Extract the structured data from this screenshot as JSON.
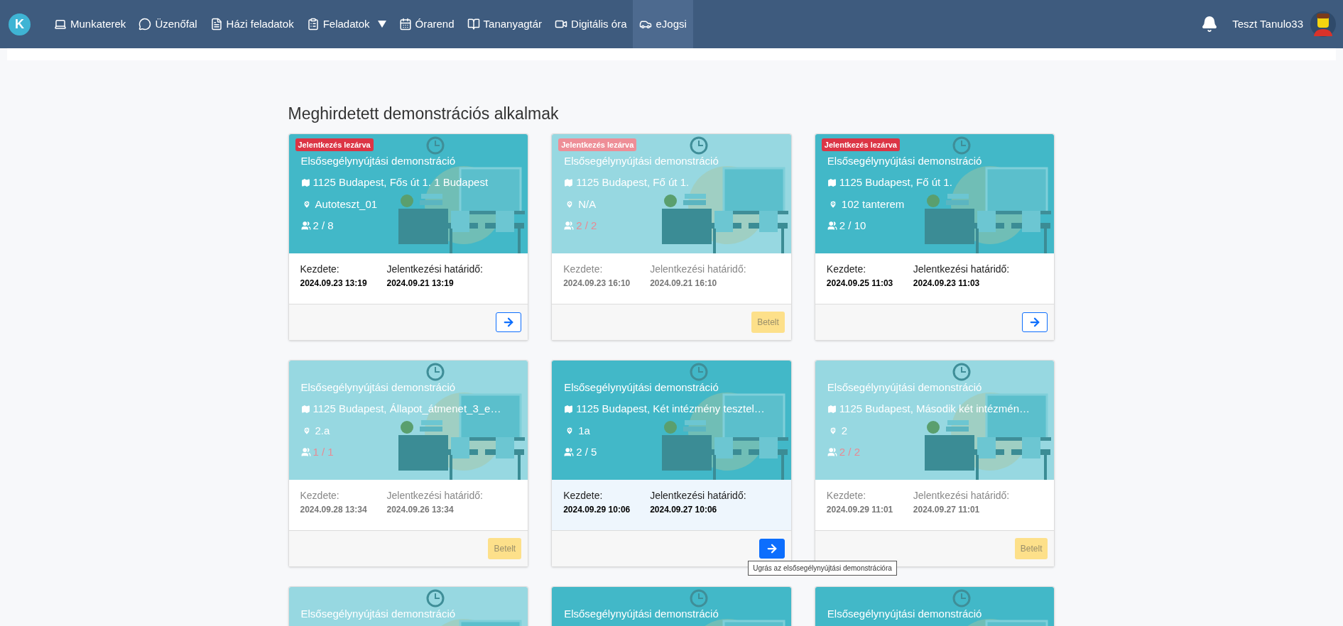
{
  "navbar": {
    "logo": "K",
    "items": [
      {
        "label": "Munkaterek",
        "selected": false,
        "dropdown": false
      },
      {
        "label": "Üzenőfal",
        "selected": false,
        "dropdown": false
      },
      {
        "label": "Házi feladatok",
        "selected": false,
        "dropdown": false
      },
      {
        "label": "Feladatok",
        "selected": false,
        "dropdown": true
      },
      {
        "label": "Órarend",
        "selected": false,
        "dropdown": false
      },
      {
        "label": "Tananyagtár",
        "selected": false,
        "dropdown": false
      },
      {
        "label": "Digitális óra",
        "selected": false,
        "dropdown": false
      },
      {
        "label": "eJogsi",
        "selected": true,
        "dropdown": false
      }
    ],
    "user": "Teszt Tanulo33"
  },
  "heading": "Meghirdetett demonstrációs alkalmak",
  "cards": [
    {
      "badge": "Jelentkezés lezárva",
      "full": false,
      "highlighted": false,
      "title": "Elsősegélynyújtási demonstráció",
      "address": "1125 Budapest, Fős út 1. 1 Budapest",
      "room": "Autoteszt_01",
      "count": "2 / 8",
      "start_label": "Kezdete:",
      "start": "2024.09.23 13:19",
      "deadline_label": "Jelentkezési határidő:",
      "deadline": "2024.09.21 13:19",
      "button": {
        "kind": "arrow"
      }
    },
    {
      "badge": "Jelentkezés lezárva",
      "full": true,
      "highlighted": false,
      "title": "Elsősegélynyújtási demonstráció",
      "address": "1125 Budapest, Fő út 1.",
      "room": "N/A",
      "count": "2 / 2",
      "start_label": "Kezdete:",
      "start": "2024.09.23 16:10",
      "deadline_label": "Jelentkezési határidő:",
      "deadline": "2024.09.21 16:10",
      "button": {
        "kind": "label",
        "label": "Betelt"
      }
    },
    {
      "badge": "Jelentkezés lezárva",
      "full": false,
      "highlighted": false,
      "title": "Elsősegélynyújtási demonstráció",
      "address": "1125 Budapest, Fő út 1.",
      "room": "102 tanterem",
      "count": "2 / 10",
      "start_label": "Kezdete:",
      "start": "2024.09.25 11:03",
      "deadline_label": "Jelentkezési határidő:",
      "deadline": "2024.09.23 11:03",
      "button": {
        "kind": "arrow"
      }
    },
    {
      "full": true,
      "highlighted": false,
      "title": "Elsősegélynyújtási demonstráció",
      "address": "1125 Budapest, Állapot_átmenet_3_e…",
      "room": "2.a",
      "count": "1 / 1",
      "start_label": "Kezdete:",
      "start": "2024.09.28 13:34",
      "deadline_label": "Jelentkezési határidő:",
      "deadline": "2024.09.26 13:34",
      "button": {
        "kind": "label",
        "label": "Betelt"
      }
    },
    {
      "full": false,
      "highlighted": true,
      "title": "Elsősegélynyújtási demonstráció",
      "address": "1125 Budapest, Két intézmény tesztel…",
      "room": "1a",
      "count": "2 / 5",
      "start_label": "Kezdete:",
      "start": "2024.09.29 10:06",
      "deadline_label": "Jelentkezési határidő:",
      "deadline": "2024.09.27 10:06",
      "button": {
        "kind": "arrow",
        "tooltip": "Ugrás az elsősegélynyújtási demonstrációra"
      }
    },
    {
      "full": true,
      "highlighted": false,
      "title": "Elsősegélynyújtási demonstráció",
      "address": "1125 Budapest, Második két intézmén…",
      "room": "2",
      "count": "2 / 2",
      "start_label": "Kezdete:",
      "start": "2024.09.29 11:01",
      "deadline_label": "Jelentkezési határidő:",
      "deadline": "2024.09.27 11:01",
      "button": {
        "kind": "label",
        "label": "Betelt"
      }
    },
    {
      "full": true,
      "title": "Elsősegélynyújtási demonstráció"
    },
    {
      "full": false,
      "title": "Elsősegélynyújtási demonstráció"
    },
    {
      "full": false,
      "title": "Elsősegélynyújtási demonstráció"
    }
  ]
}
